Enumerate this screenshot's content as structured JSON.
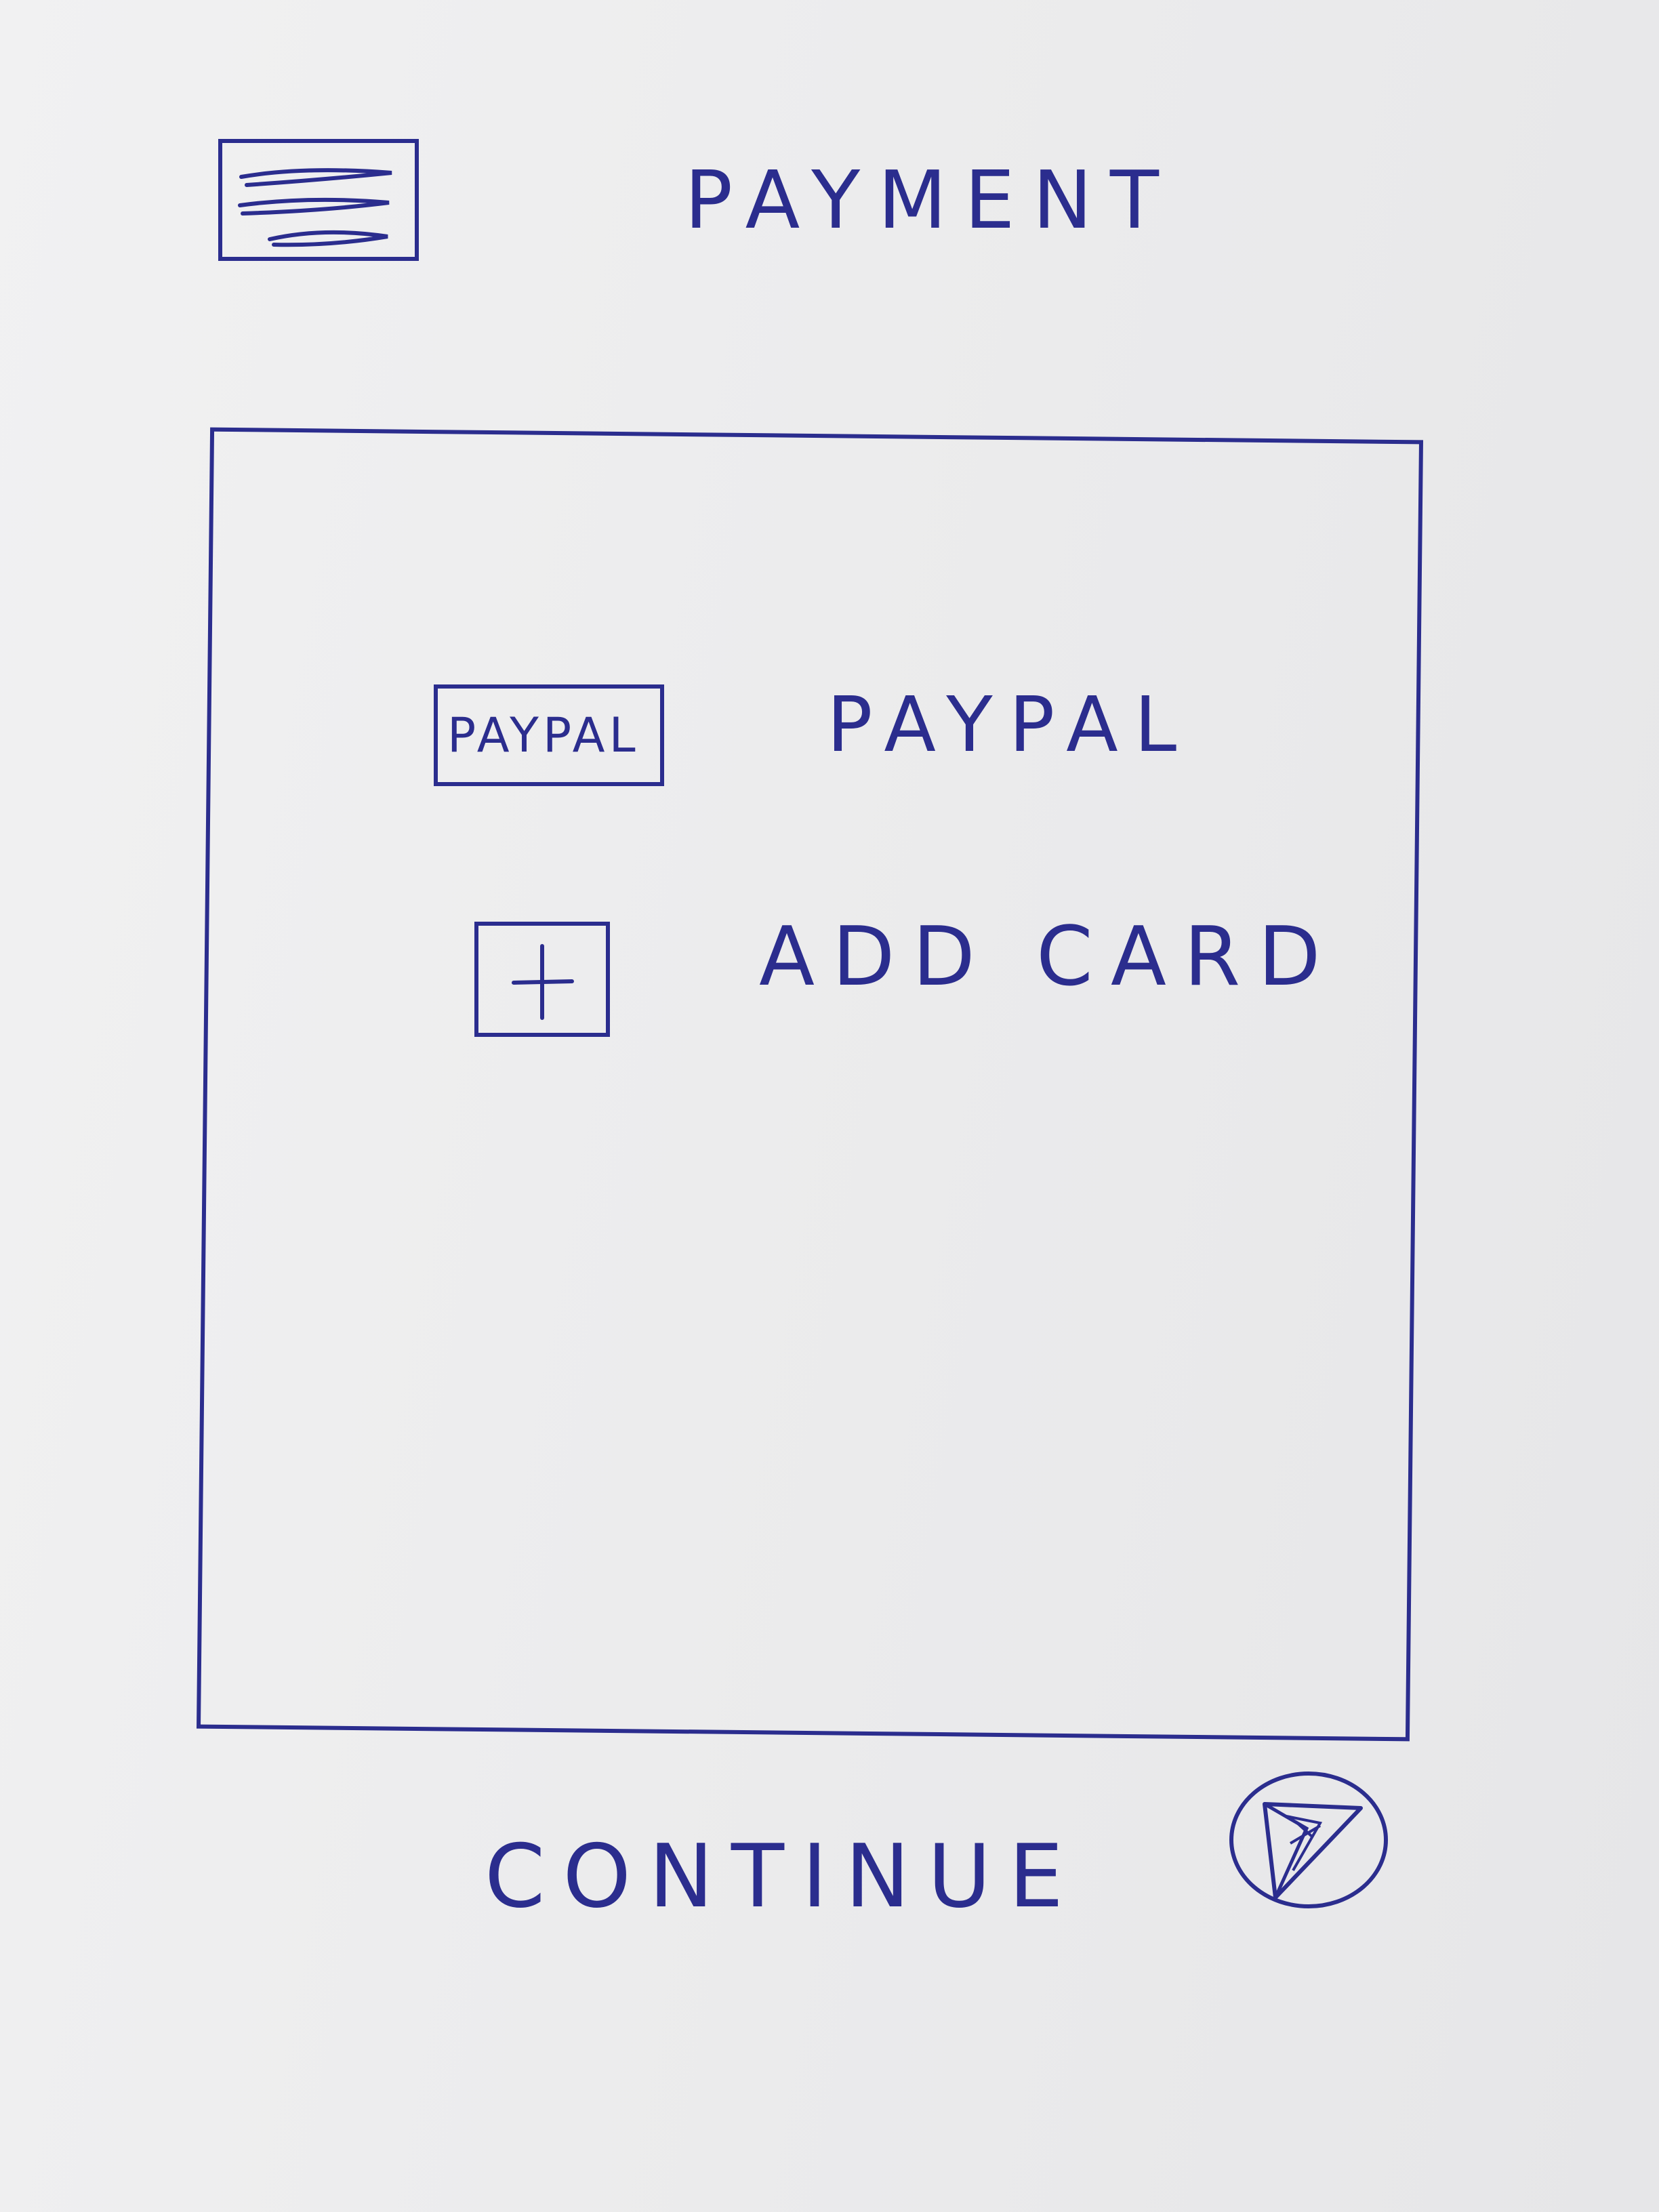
{
  "header": {
    "title": "PAYMENT",
    "menu_icon": "hamburger-menu-icon"
  },
  "payment_options": [
    {
      "logo_text": "PAYPAL",
      "label": "PAYPAL",
      "icon": "paypal-logo"
    },
    {
      "label": "ADD CARD",
      "icon": "plus-icon"
    }
  ],
  "footer": {
    "continue_label": "CONTINUE",
    "continue_icon": "send-arrow-icon"
  },
  "colors": {
    "ink": "#2b2d8e",
    "paper": "#ededee"
  }
}
